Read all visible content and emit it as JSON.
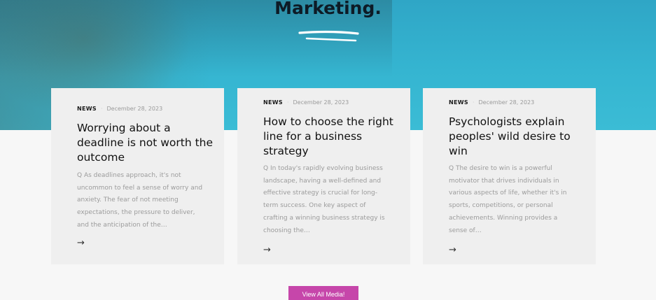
{
  "hero": {
    "title": "Marketing.",
    "background_color": "#35b5d1"
  },
  "cards": [
    {
      "category": "NEWS",
      "separator": "·",
      "date": "December 28, 2023",
      "title": "Worrying about a deadline is not worth the outcome",
      "excerpt": "Q As deadlines approach, it's not uncommon to feel a sense of worry and anxiety. The fear of not meeting expectations, the pressure to deliver, and the anticipation of the…",
      "arrow": "→"
    },
    {
      "category": "NEWS",
      "separator": "·",
      "date": "December 28, 2023",
      "title": "How to choose the right line for a business strategy",
      "excerpt": "Q In today's rapidly evolving business landscape, having a well-defined and effective strategy is crucial for long-term success. One key aspect of crafting a winning business strategy is choosing the…",
      "arrow": "→"
    },
    {
      "category": "NEWS",
      "separator": "·",
      "date": "December 28, 2023",
      "title": "Psychologists explain peoples' wild desire to win",
      "excerpt": "Q The desire to win is a powerful motivator that drives individuals in various aspects of life, whether it's in sports, competitions, or personal achievements. Winning provides a sense of…",
      "arrow": "→"
    }
  ],
  "view_all_button": {
    "label": "View All Media!",
    "color": "#c646aa"
  }
}
